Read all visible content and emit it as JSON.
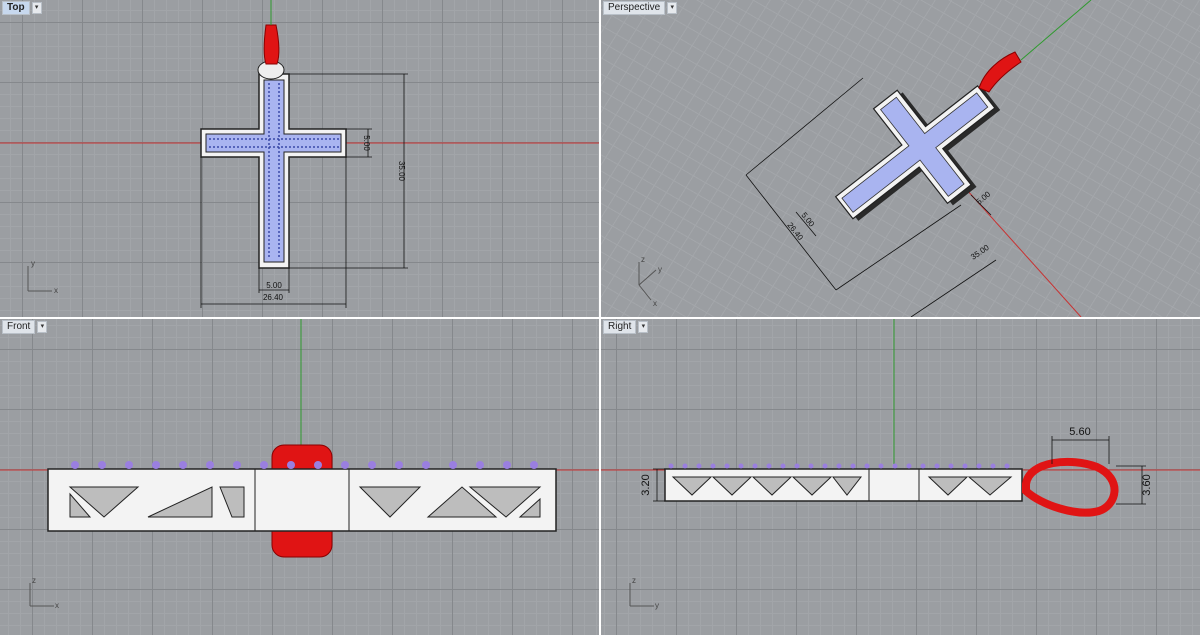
{
  "viewports": {
    "top": {
      "label": "Top",
      "active": true
    },
    "perspective": {
      "label": "Perspective"
    },
    "front": {
      "label": "Front"
    },
    "right": {
      "label": "Right"
    }
  },
  "dropdown_glyph": "▾",
  "dimensions": {
    "top": {
      "width_arm": "5.00",
      "height": "35.00",
      "width_total": "26.40",
      "width_stem": "5.00"
    },
    "perspective": {
      "width_arm": "5.00",
      "width_total": "26.40",
      "arm": "5.00",
      "height": "35.00"
    },
    "right": {
      "bail_width": "5.60",
      "thickness": "3.20",
      "bail_height": "3.60"
    }
  },
  "axes": {
    "top": {
      "x": "x",
      "y": "y"
    },
    "perspective": {
      "x": "x",
      "y": "y",
      "z": "z"
    },
    "front": {
      "x": "x",
      "z": "z"
    },
    "right": {
      "y": "y",
      "z": "z"
    }
  },
  "colors": {
    "metal": "#f3f3f3",
    "stone_fill": "#a9b4f0",
    "gem": "#9a7fe0",
    "bail": "#e01414",
    "axis_x": "#c83232",
    "axis_y": "#2f9a2f"
  },
  "icons": [
    "dropdown-arrow-icon",
    "axis-triad-icon"
  ]
}
